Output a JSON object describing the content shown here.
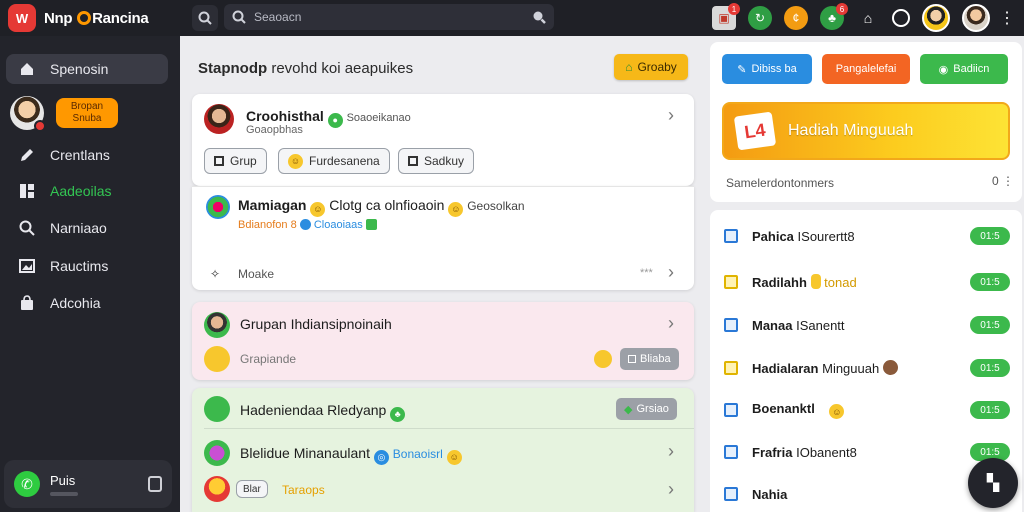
{
  "app": {
    "logo_mark": "W",
    "title_prefix": "Nnp",
    "title_suffix": "Rancina"
  },
  "search": {
    "placeholder": "Seaoacn"
  },
  "topbar": {
    "gift_badge": "1",
    "shop_badge": "6"
  },
  "sidebar": {
    "items": [
      {
        "label": "Spenosin",
        "icon": "house-icon"
      },
      {
        "label": "Crentlans",
        "icon": "pencil-icon"
      },
      {
        "label": "Aadeoilas",
        "icon": "grid-icon"
      },
      {
        "label": "Narniaao",
        "icon": "search-icon"
      },
      {
        "label": "Rauctims",
        "icon": "image-icon"
      },
      {
        "label": "Adcohia",
        "icon": "bag-icon"
      }
    ],
    "promo_button": "Bropan Snuba",
    "user_name": "Puis"
  },
  "feed": {
    "title_bold": "Stapnodp",
    "title_rest": "revohd koi aeapuikes",
    "action_button": "Groaby",
    "cards": [
      {
        "title": "Croohisthal",
        "meta": "Soaoeikanao",
        "subtitle": "Goaopbhas",
        "chips": [
          "Grup",
          "Furdesanena",
          "Sadkuy"
        ]
      },
      {
        "title": "Mamiagan",
        "text_1": "Clotg ca olnfioaoin",
        "text_2": "Geosolkan",
        "line_red": "Bdianofon 8",
        "line_blue": "Cloaoiaas",
        "footer_label": "Moake",
        "footer_meta": "***"
      },
      {
        "title": "Grupan Ihdiansipnoinaih",
        "subtitle": "Grapiande",
        "pill": "Bliaba"
      },
      {
        "title": "Hadeniendaa Rledyanp",
        "pill": "Grsiao"
      },
      {
        "title": "Blelidue Minanaulant",
        "meta": "Bonaoisrl"
      },
      {
        "chip": "Blar",
        "label": "Taraops"
      }
    ]
  },
  "right": {
    "buttons": [
      "Dibiss ba",
      "Pangalelefai",
      "Badiicn"
    ],
    "banner_text": "Hadiah Minguuah",
    "footer": "Samelerdontonmers",
    "footer_icon": "0",
    "list": [
      {
        "bold": "Pahica",
        "rest": "ISourertt8",
        "badge": "01:5"
      },
      {
        "bold": "Radilahh",
        "rest": "tonad",
        "badge": "01:5"
      },
      {
        "bold": "Manaa",
        "rest": "ISanentt",
        "badge": "01:5"
      },
      {
        "bold": "Hadialaran",
        "rest": "Minguuah",
        "badge": "01:5"
      },
      {
        "bold": "Boenanktl",
        "rest": "",
        "badge": "01:5"
      },
      {
        "bold": "Frafria",
        "rest": "IObanent8",
        "badge": "01:5"
      },
      {
        "bold": "Nahia",
        "rest": "",
        "badge": ""
      }
    ]
  },
  "colors": {
    "sidebar_bg": "#23242b",
    "accent_green": "#3cb94c",
    "accent_orange": "#ff9800",
    "accent_blue": "#2a8de0"
  }
}
